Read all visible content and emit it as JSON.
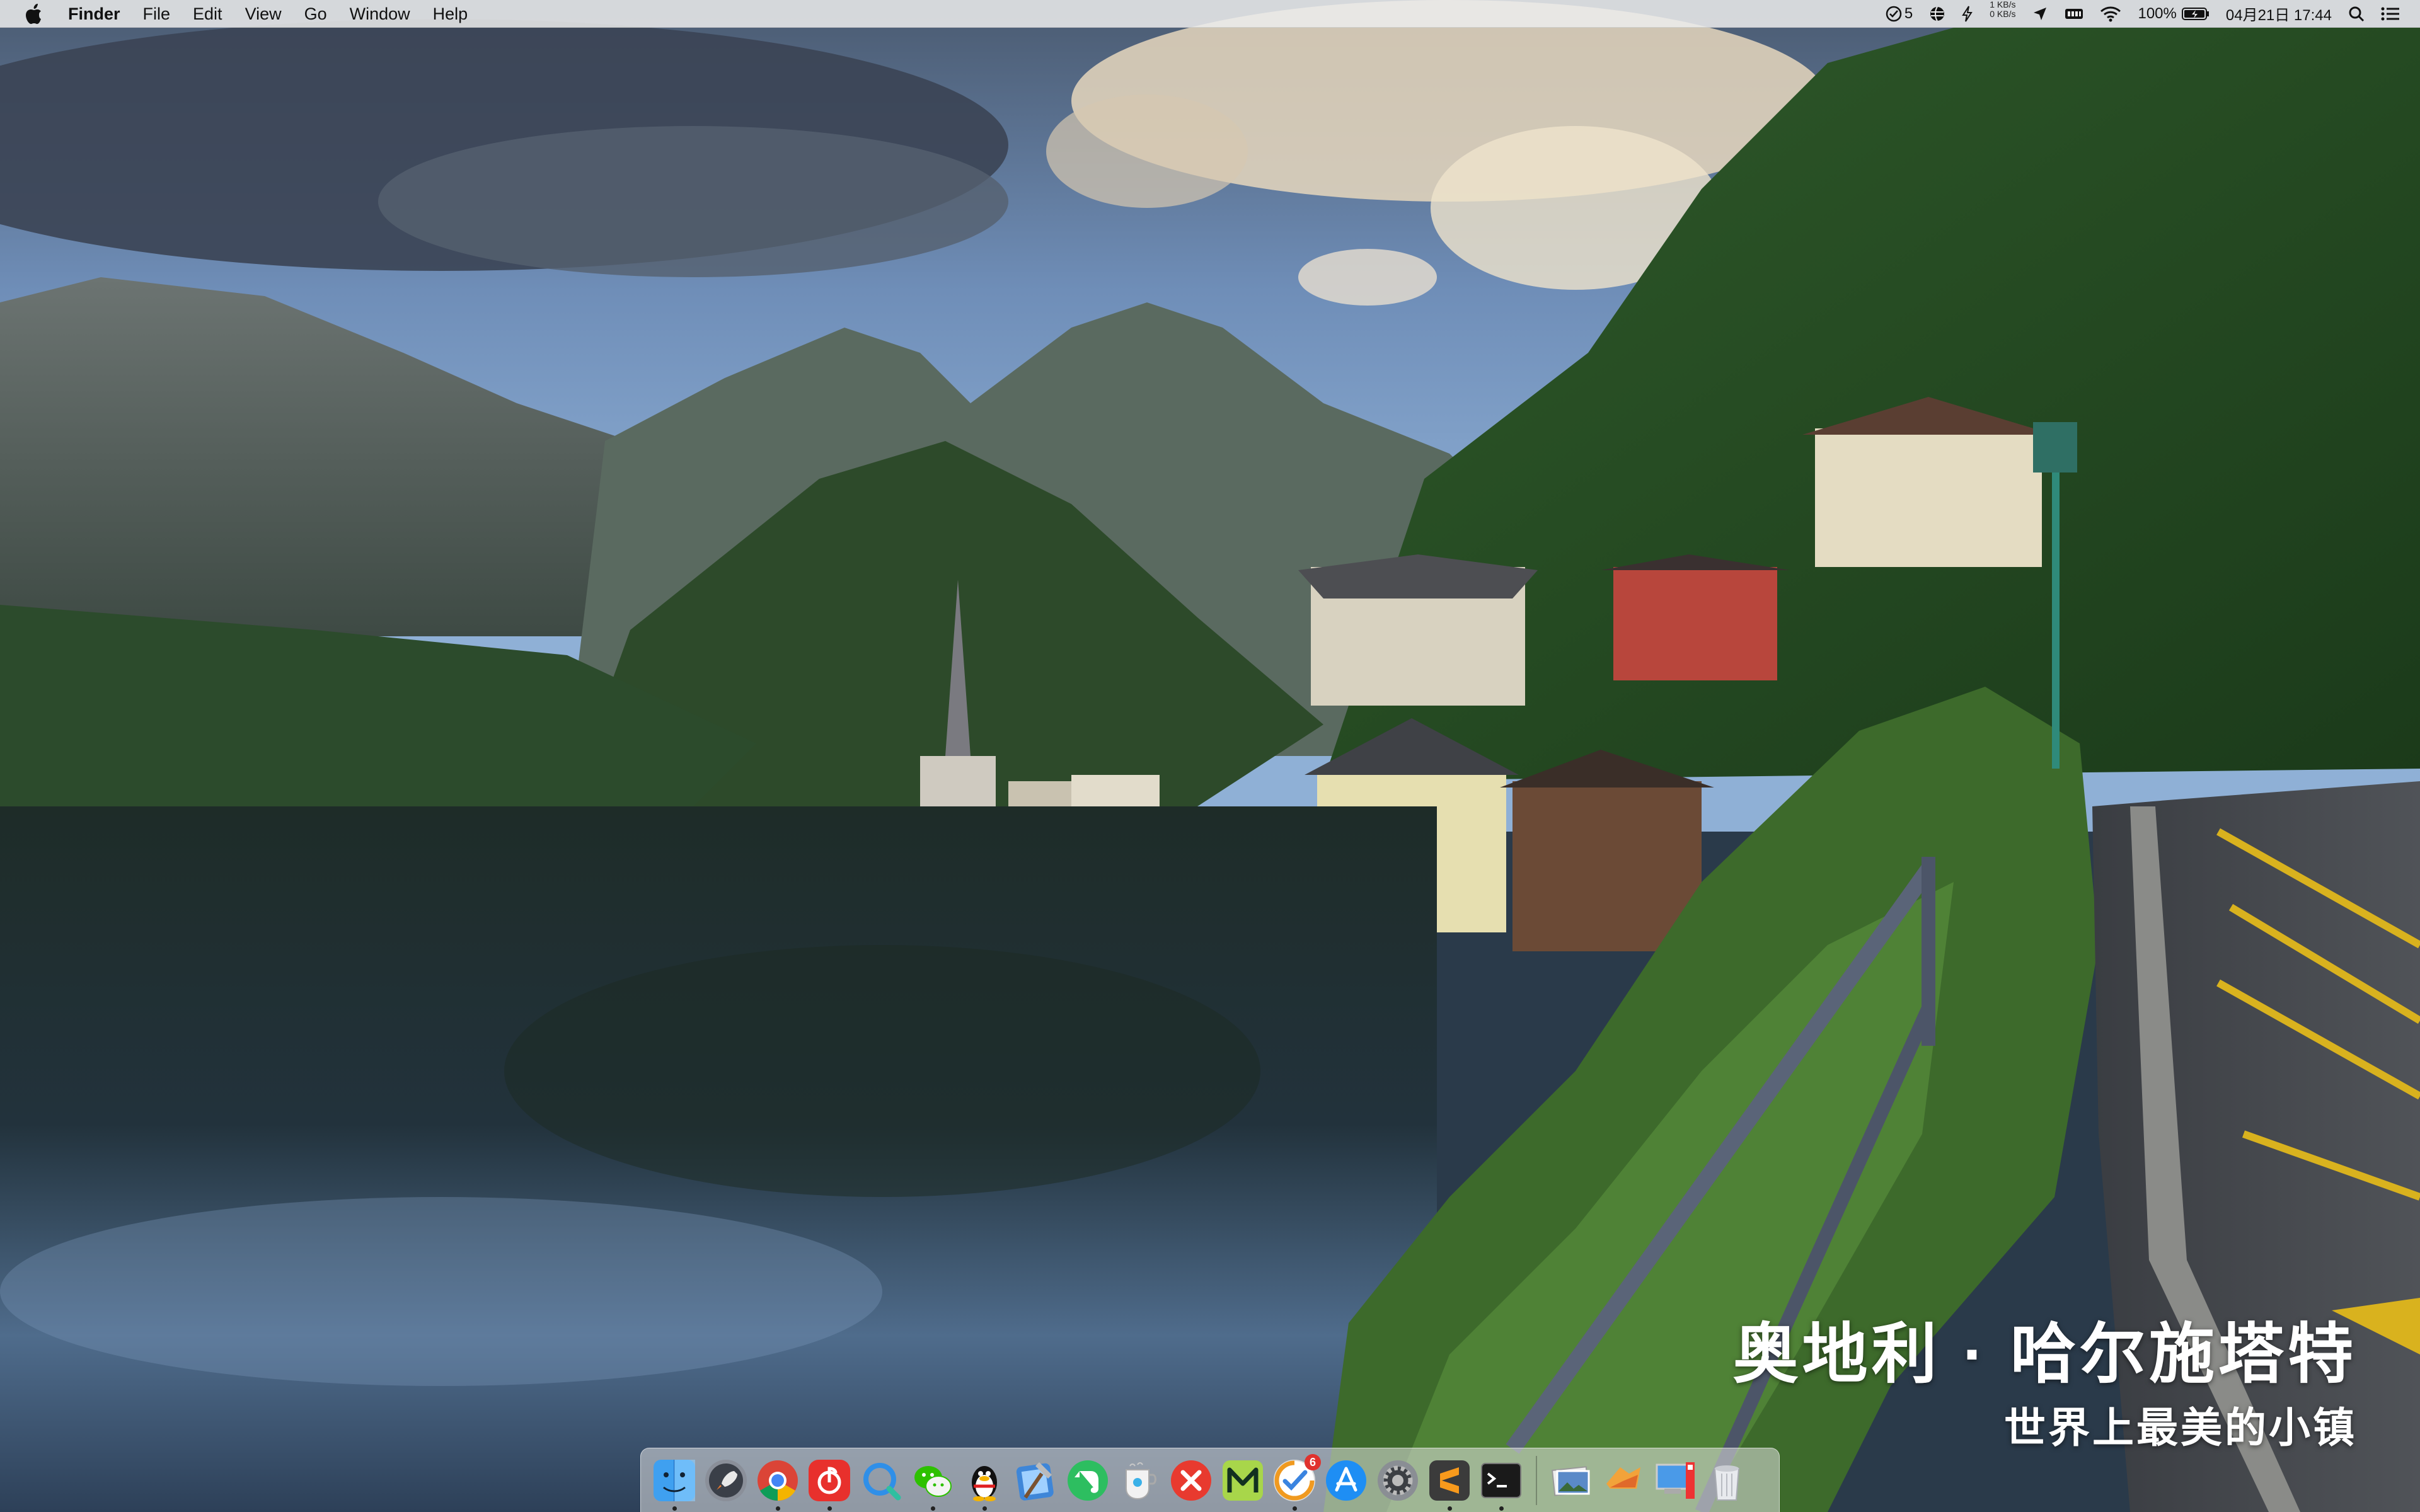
{
  "menubar": {
    "apple_icon": "apple-icon",
    "app_name": "Finder",
    "menus": [
      "File",
      "Edit",
      "View",
      "Go",
      "Window",
      "Help"
    ],
    "status": {
      "task_icon": "checkmark-circle-icon",
      "task_count": "5",
      "net_up": "1 KB/s",
      "net_down": "0 KB/s",
      "battery_percent": "100%",
      "datetime": "04月21日 17:44"
    }
  },
  "caption": {
    "title": "奥地利 · 哈尔施塔特",
    "subtitle": "世界上最美的小镇"
  },
  "dock": {
    "apps": [
      {
        "name": "finder",
        "icon": "finder-icon",
        "running": true
      },
      {
        "name": "launchpad",
        "icon": "rocket-icon",
        "running": false
      },
      {
        "name": "chrome",
        "icon": "chrome-icon",
        "running": true
      },
      {
        "name": "netease-music",
        "icon": "music-icon",
        "running": true
      },
      {
        "name": "qq-browser",
        "icon": "browser-icon",
        "running": false
      },
      {
        "name": "wechat",
        "icon": "wechat-icon",
        "running": true
      },
      {
        "name": "qq",
        "icon": "penguin-icon",
        "running": true
      },
      {
        "name": "xcode-toolbox",
        "icon": "hammer-icon",
        "running": false
      },
      {
        "name": "evernote",
        "icon": "elephant-icon",
        "running": false
      },
      {
        "name": "preview",
        "icon": "cup-icon",
        "running": false
      },
      {
        "name": "xmind",
        "icon": "x-icon",
        "running": false
      },
      {
        "name": "mweb",
        "icon": "m-icon",
        "running": false
      },
      {
        "name": "omnifocus",
        "icon": "target-icon",
        "running": true,
        "badge": "6"
      },
      {
        "name": "app-store",
        "icon": "appstore-icon",
        "running": false
      },
      {
        "name": "system-preferences",
        "icon": "gear-icon",
        "running": false
      },
      {
        "name": "sublime-text",
        "icon": "sublime-icon",
        "running": true
      },
      {
        "name": "terminal",
        "icon": "terminal-icon",
        "running": true
      }
    ],
    "others": [
      {
        "name": "preview-docs",
        "icon": "photos-icon"
      },
      {
        "name": "downloads",
        "icon": "stack-icon"
      },
      {
        "name": "screen-sharing",
        "icon": "desktop-icon"
      },
      {
        "name": "trash",
        "icon": "trash-icon"
      }
    ]
  }
}
